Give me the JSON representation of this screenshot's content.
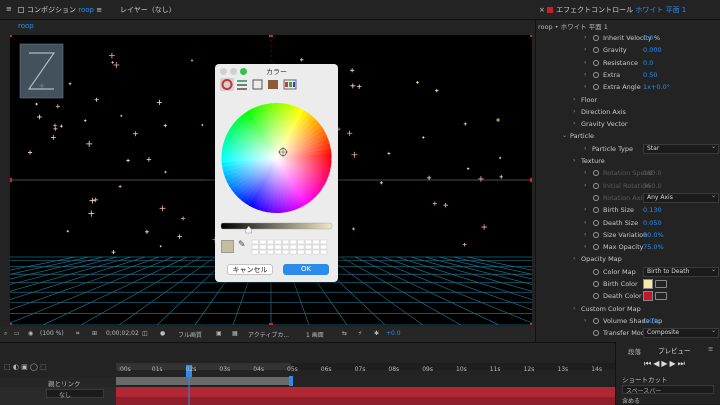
{
  "comp_panel": {
    "tab_prefix": "コンポジション",
    "comp_name": "roop",
    "layer_tab": "レイヤー（なし）",
    "breadcrumb": "roop"
  },
  "effects_panel": {
    "tab_prefix": "エフェクトコントロール",
    "layer_name": "ホワイト 平面 1",
    "breadcrumb": "roop • ホワイト 平面 1",
    "rows": [
      {
        "name": "Inherit Velocity %",
        "value": "0.0",
        "indent": 2,
        "twirl": true,
        "stopwatch": true
      },
      {
        "name": "Gravity",
        "value": "0.000",
        "indent": 2,
        "twirl": true,
        "stopwatch": true
      },
      {
        "name": "Resistance",
        "value": "0.0",
        "indent": 2,
        "twirl": true,
        "stopwatch": true
      },
      {
        "name": "Extra",
        "value": "0.50",
        "indent": 2,
        "twirl": true,
        "stopwatch": true
      },
      {
        "name": "Extra Angle",
        "value": "1x+0.0°",
        "indent": 2,
        "twirl": true,
        "stopwatch": true
      },
      {
        "name": "Floor",
        "value": "",
        "indent": 1,
        "twirl": true,
        "stopwatch": false
      },
      {
        "name": "Direction Axis",
        "value": "",
        "indent": 1,
        "twirl": true,
        "stopwatch": false
      },
      {
        "name": "Gravity Vector",
        "value": "",
        "indent": 1,
        "twirl": true,
        "stopwatch": false
      },
      {
        "name": "Particle",
        "value": "",
        "indent": 0,
        "twirl": true,
        "stopwatch": false,
        "open": true
      },
      {
        "name": "Particle Type",
        "value": "",
        "indent": 2,
        "twirl": true,
        "stopwatch": false,
        "dropdown": "Star"
      },
      {
        "name": "Texture",
        "value": "",
        "indent": 1,
        "twirl": true,
        "stopwatch": false
      },
      {
        "name": "Rotation Speed",
        "value": "180.0",
        "indent": 2,
        "twirl": true,
        "stopwatch": true,
        "dim": true
      },
      {
        "name": "Initial Rotation",
        "value": "360.0",
        "indent": 2,
        "twirl": true,
        "stopwatch": true,
        "dim": true
      },
      {
        "name": "Rotation Axis",
        "value": "",
        "indent": 2,
        "twirl": false,
        "stopwatch": true,
        "dim": true,
        "dropdown": "Any Axis"
      },
      {
        "name": "Birth Size",
        "value": "0.130",
        "indent": 2,
        "twirl": true,
        "stopwatch": true
      },
      {
        "name": "Death Size",
        "value": "0.050",
        "indent": 2,
        "twirl": true,
        "stopwatch": true
      },
      {
        "name": "Size Variation",
        "value": "50.0%",
        "indent": 2,
        "twirl": true,
        "stopwatch": true
      },
      {
        "name": "Max Opacity",
        "value": "75.0%",
        "indent": 2,
        "twirl": true,
        "stopwatch": true
      },
      {
        "name": "Opacity Map",
        "value": "",
        "indent": 1,
        "twirl": true,
        "stopwatch": false
      },
      {
        "name": "Color Map",
        "value": "",
        "indent": 2,
        "twirl": false,
        "stopwatch": true,
        "dropdown": "Birth to Death"
      },
      {
        "name": "Birth Color",
        "value": "",
        "indent": 2,
        "twirl": false,
        "stopwatch": true,
        "chip": "#f4eba8"
      },
      {
        "name": "Death Color",
        "value": "",
        "indent": 2,
        "twirl": false,
        "stopwatch": true,
        "chip": "#c4162a"
      },
      {
        "name": "Custom Color Map",
        "value": "",
        "indent": 1,
        "twirl": true,
        "stopwatch": false
      },
      {
        "name": "Volume Shade (ap",
        "value": "0.0%",
        "indent": 2,
        "twirl": true,
        "stopwatch": true
      },
      {
        "name": "Transfer Mode",
        "value": "",
        "indent": 2,
        "twirl": false,
        "stopwatch": true,
        "dropdown": "Composite"
      }
    ]
  },
  "color_dialog": {
    "title": "カラー",
    "cancel": "キャンセル",
    "ok": "OK",
    "brightness": 0.25,
    "preview_color": "#c6bd9c",
    "accent": "#2d8ceb"
  },
  "viewer_toolbar": {
    "zoom": "(100 %)",
    "timecode": "0;00;02;02",
    "quality": "フル画質",
    "camera": "アクティブカ...",
    "views": "1 画面",
    "offset": "+0.0"
  },
  "timeline": {
    "ticks": [
      ":00s",
      "01s",
      "02s",
      "03s",
      "04s",
      "05s",
      "06s",
      "07s",
      "08s",
      "09s",
      "10s",
      "11s",
      "12s",
      "13s",
      "14s"
    ],
    "parent_label": "親とリンク",
    "parent_value": "なし"
  },
  "right_panels": {
    "paragraph": "段落",
    "preview": "プレビュー",
    "shortcut_label": "ショートカット",
    "shortcut_value": "スペースバー",
    "footer": "含める"
  }
}
